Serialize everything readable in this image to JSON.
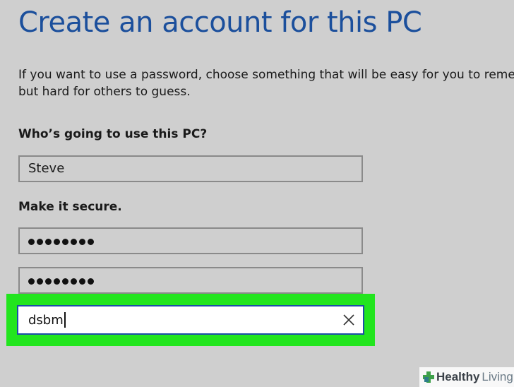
{
  "page": {
    "title": "Create an account for this PC",
    "description_lines": [
      "If you want to use a password, choose something that will be easy for you to remem",
      "but hard for others to guess."
    ]
  },
  "form": {
    "who_label": "Who’s going to use this PC?",
    "username_value": "Steve",
    "secure_label": "Make it secure.",
    "password_mask_length": 8,
    "confirm_password_mask_length": 8,
    "hint_value": "dsbm"
  },
  "icons": {
    "clear": "close-icon",
    "watermark_logo": "plus-icon"
  },
  "colors": {
    "title": "#1b4f9c",
    "highlight": "#22e51e",
    "focus_border": "#1c4ea6",
    "background": "#cfcfcf"
  },
  "watermark": {
    "brand_part1": "Healthy",
    "brand_part2": "Living"
  }
}
